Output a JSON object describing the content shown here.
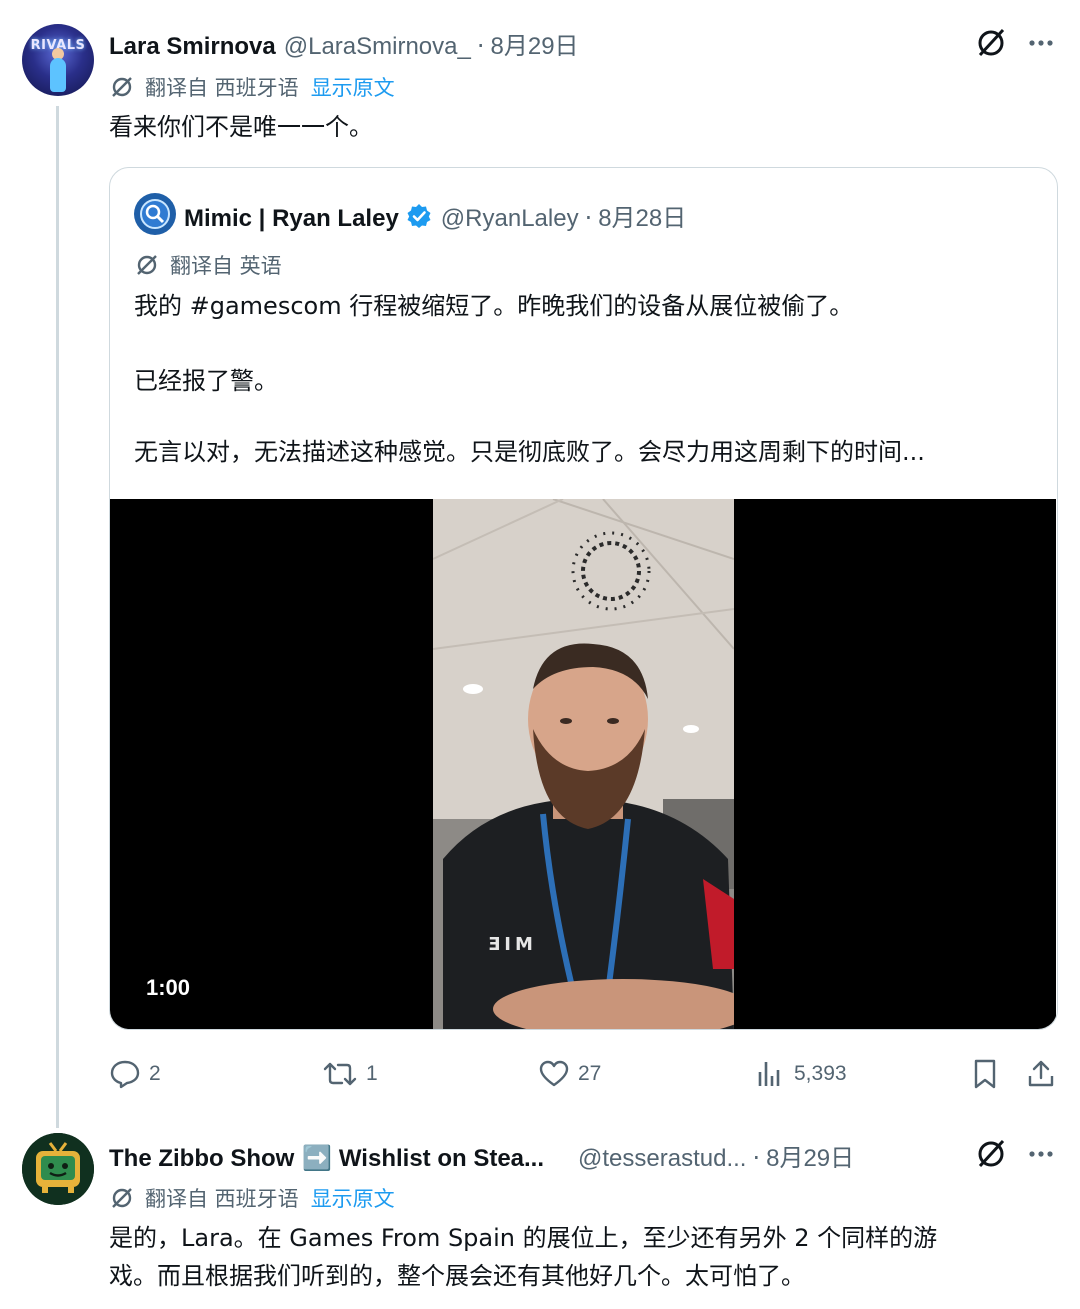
{
  "tweets": [
    {
      "author_name": "Lara Smirnova",
      "handle": "@LaraSmirnova_",
      "separator": "·",
      "date": "8月29日",
      "translate_label": "翻译自 西班牙语",
      "show_original": "显示原文",
      "text": "看来你们不是唯一一个。",
      "avatar_text": "RIVALS"
    },
    {
      "author_name": "The Zibbo Show",
      "author_suffix": "➡️ Wishlist on Stea...",
      "handle": "@tesserastud...",
      "separator": "·",
      "date": "8月29日",
      "translate_label": "翻译自 西班牙语",
      "show_original": "显示原文",
      "text_line1": "是的，Lara。在 Games From Spain 的展位上，至少还有另外 2 个同样的游",
      "text_line2": "戏。而且根据我们听到的，整个展会还有其他好几个。太可怕了。"
    }
  ],
  "quoted": {
    "author_name": "Mimic | Ryan Laley",
    "handle": "@RyanLaley",
    "separator": "·",
    "date": "8月28日",
    "translate_label": "翻译自 英语",
    "para1": "我的 #gamescom 行程被缩短了。昨晚我们的设备从展位被偷了。",
    "para2": "已经报了警。",
    "para3": "无言以对，无法描述这种感觉。只是彻底败了。会尽力用这周剩下的时间...",
    "video_duration": "1:00",
    "shirt_logo": "ƎIM"
  },
  "actions": {
    "replies": "2",
    "retweets": "1",
    "likes": "27",
    "views": "5,393"
  },
  "colors": {
    "accent": "#1d9bf0",
    "muted": "#536471",
    "border": "#cfd9de"
  },
  "icons": [
    "grok-icon",
    "more-icon",
    "translate-icon",
    "verified-badge-icon",
    "reply-icon",
    "retweet-icon",
    "like-icon",
    "views-icon",
    "bookmark-icon",
    "share-icon"
  ]
}
